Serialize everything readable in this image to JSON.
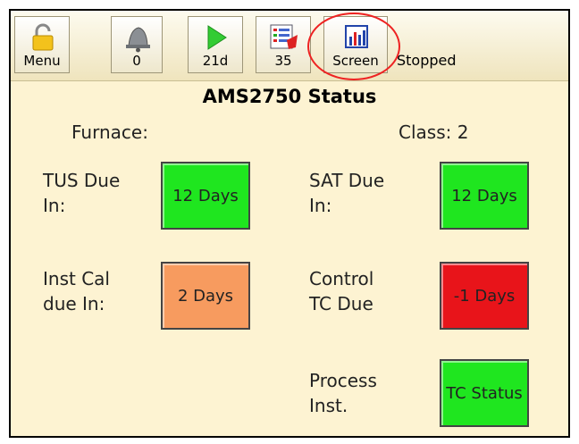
{
  "toolbar": {
    "menu_label": "Menu",
    "alarm_label": "0",
    "run_label": "21d",
    "messages_label": "35",
    "screen_label": "Screen",
    "status_text": "Stopped"
  },
  "page": {
    "title": "AMS2750 Status",
    "furnace_label": "Furnace:",
    "class_label": "Class: 2"
  },
  "items": {
    "tus": {
      "label_line1": "TUS Due",
      "label_line2": "In:",
      "value": "12 Days",
      "color": "#1fe61f"
    },
    "sat": {
      "label_line1": "SAT Due",
      "label_line2": "In:",
      "value": "12 Days",
      "color": "#1fe61f"
    },
    "inst_cal": {
      "label_line1": "Inst Cal",
      "label_line2": "due In:",
      "value": "2 Days",
      "color": "#f79b5f"
    },
    "control_tc": {
      "label_line1": "Control",
      "label_line2": "TC Due",
      "value": "-1 Days",
      "color": "#e8141a"
    },
    "process": {
      "label_line1": "Process",
      "label_line2": "Inst.",
      "value": "TC Status",
      "color": "#1fe61f"
    }
  },
  "colors": {
    "background": "#fdf3d2",
    "highlight": "#e22222"
  }
}
